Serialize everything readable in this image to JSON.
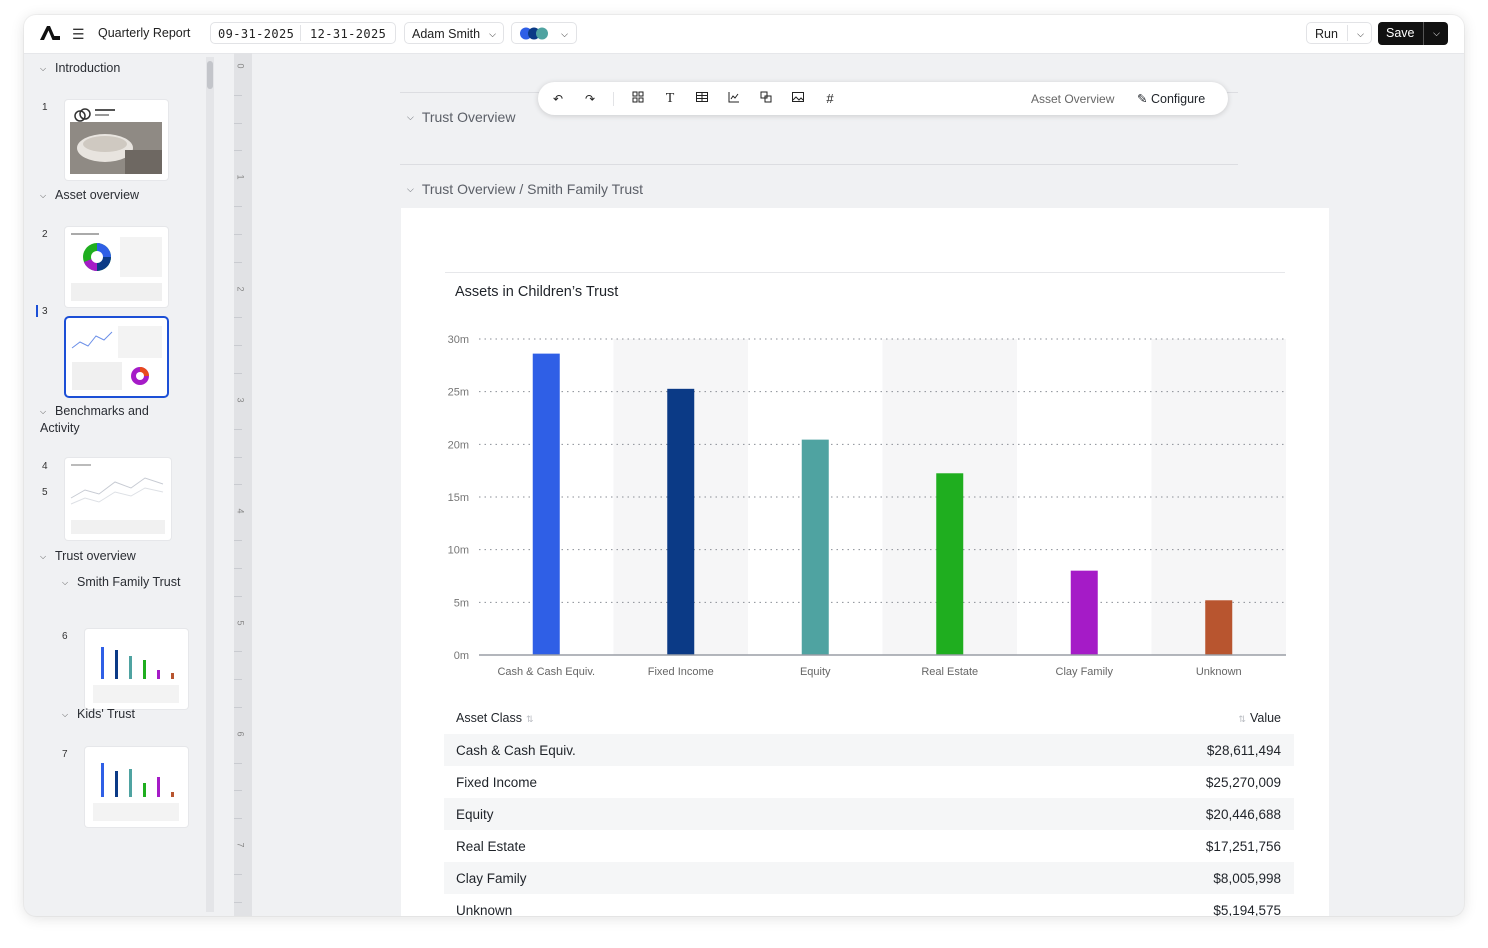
{
  "topbar": {
    "title": "Quarterly Report",
    "date_start": "09-31-2025",
    "date_end": "12-31-2025",
    "user": "Adam Smith",
    "run_label": "Run",
    "save_label": "Save"
  },
  "sidebar": {
    "sections": {
      "intro": "Introduction",
      "asset": "Asset overview",
      "bench": "Benchmarks and Activity",
      "trust": "Trust overview",
      "smith": "Smith Family Trust",
      "kids": "Kids' Trust"
    },
    "page_numbers": [
      "1",
      "2",
      "3",
      "4",
      "5",
      "6",
      "7"
    ]
  },
  "ruler": [
    "0",
    "1",
    "2",
    "3",
    "4",
    "5",
    "6",
    "7"
  ],
  "canvas": {
    "section1": "Trust Overview",
    "section2": "Trust Overview / Smith Family Trust",
    "toolbar": {
      "asset_link": "Asset Overview",
      "configure_label": "Configure"
    }
  },
  "chart_data": {
    "type": "bar",
    "title": "Assets in Children’s Trust",
    "categories": [
      "Cash & Cash Equiv.",
      "Fixed Income",
      "Equity",
      "Real Estate",
      "Clay Family",
      "Unknown"
    ],
    "values": [
      28611494,
      25270009,
      20446688,
      17251756,
      8005998,
      5194575
    ],
    "colors": [
      "#2f5fe6",
      "#0b3a86",
      "#4fa3a1",
      "#1fae1f",
      "#a51bc7",
      "#b8552f"
    ],
    "y_ticks": [
      "0m",
      "5m",
      "10m",
      "15m",
      "20m",
      "25m",
      "30m"
    ],
    "ylim": [
      0,
      30000000
    ],
    "grid": true,
    "gridline_style": "dotted"
  },
  "table": {
    "col1": "Asset Class",
    "col2": "Value",
    "rows": [
      {
        "label": "Cash & Cash Equiv.",
        "value": "$28,611,494"
      },
      {
        "label": "Fixed Income",
        "value": "$25,270,009"
      },
      {
        "label": "Equity",
        "value": "$20,446,688"
      },
      {
        "label": "Real Estate",
        "value": "$17,251,756"
      },
      {
        "label": "Clay Family",
        "value": "$8,005,998"
      },
      {
        "label": "Unknown",
        "value": "$5,194,575"
      }
    ]
  }
}
